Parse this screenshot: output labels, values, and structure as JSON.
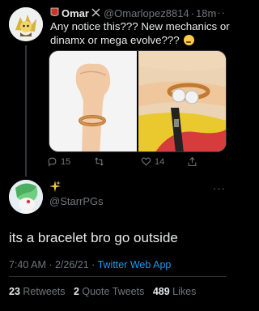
{
  "parent_tweet": {
    "author_name": "Omar",
    "author_handle": "@Omarlopez8814",
    "time": "18m",
    "separator": "·",
    "more": "···",
    "text": "Any notice this??? New mechanics or dinamx or mega evolve???",
    "actions": {
      "reply_count": "15",
      "retweet_count": "",
      "like_count": "14"
    }
  },
  "reply_tweet": {
    "author_handle": "@StarrPGs",
    "more": "···",
    "text": "its a bracelet bro go outside",
    "timestamp": "7:40 AM · 2/26/21 ·",
    "source": "Twitter Web App",
    "stats": {
      "retweets_count": "23",
      "retweets_label": "Retweets",
      "quote_count": "2",
      "quote_label": "Quote Tweets",
      "likes_count": "489",
      "likes_label": "Likes"
    }
  },
  "colors": {
    "background": "#000000",
    "text": "#e7e9ea",
    "muted": "#71767b",
    "link": "#1d9bf0",
    "divider": "#2f3336"
  },
  "icons": [
    "flag-icon",
    "crossed-swords-icon",
    "thinking-emoji-icon",
    "reply-icon",
    "retweet-icon",
    "like-icon",
    "share-icon",
    "sparkle-icon"
  ]
}
